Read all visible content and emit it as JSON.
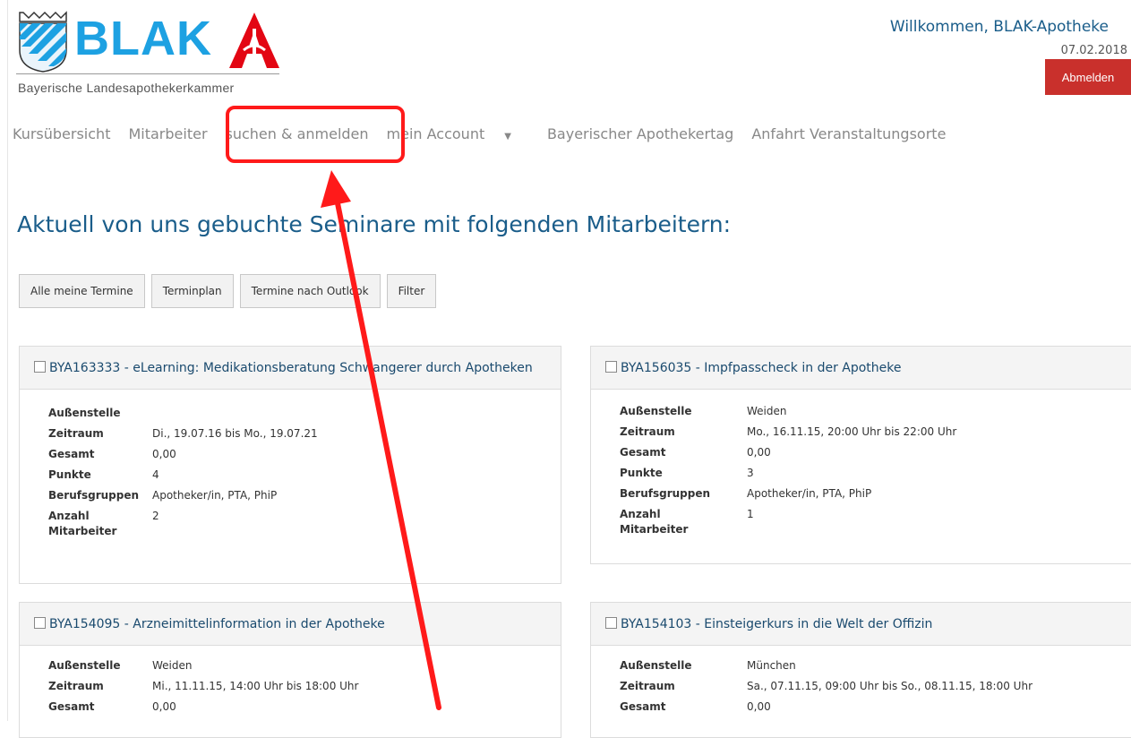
{
  "logo": {
    "word": "BLAK",
    "subtitle": "Bayerische Landesapothekerkammer"
  },
  "header": {
    "welcome": "Willkommen, BLAK-Apotheke",
    "date": "07.02.2018",
    "logout_label": "Abmelden"
  },
  "nav": {
    "items": [
      {
        "label": "Kursübersicht"
      },
      {
        "label": "Mitarbeiter"
      },
      {
        "label": "suchen & anmelden"
      },
      {
        "label": "mein Account"
      },
      {
        "label": "Bayerischer Apothekertag"
      },
      {
        "label": "Anfahrt Veranstaltungsorte"
      }
    ]
  },
  "heading": "Aktuell von uns gebuchte Seminare mit folgenden Mitarbeitern:",
  "buttons": [
    "Alle meine Termine",
    "Terminplan",
    "Termine nach Outlook",
    "Filter"
  ],
  "cards": [
    {
      "title": "BYA163333 - eLearning: Medikationsberatung Schwangerer durch Apotheken",
      "rows": [
        {
          "label": "Außenstelle",
          "value": ""
        },
        {
          "label": "Zeitraum",
          "value": "Di., 19.07.16 bis Mo., 19.07.21"
        },
        {
          "label": "Gesamt",
          "value": "0,00"
        },
        {
          "label": "Punkte",
          "value": "4"
        },
        {
          "label": "Berufsgruppen",
          "value": "Apotheker/in, PTA, PhiP"
        },
        {
          "label": "Anzahl Mitarbeiter",
          "value": "2"
        }
      ]
    },
    {
      "title": "BYA156035 - Impfpasscheck in der Apotheke",
      "rows": [
        {
          "label": "Außenstelle",
          "value": "Weiden"
        },
        {
          "label": "Zeitraum",
          "value": "Mo., 16.11.15, 20:00 Uhr bis 22:00 Uhr"
        },
        {
          "label": "Gesamt",
          "value": "0,00"
        },
        {
          "label": "Punkte",
          "value": "3"
        },
        {
          "label": "Berufsgruppen",
          "value": "Apotheker/in, PTA, PhiP"
        },
        {
          "label": "Anzahl Mitarbeiter",
          "value": "1"
        }
      ]
    },
    {
      "title": "BYA154095 - Arzneimittelinformation in der Apotheke",
      "rows": [
        {
          "label": "Außenstelle",
          "value": "Weiden"
        },
        {
          "label": "Zeitraum",
          "value": "Mi., 11.11.15, 14:00 Uhr bis 18:00 Uhr"
        },
        {
          "label": "Gesamt",
          "value": "0,00"
        }
      ]
    },
    {
      "title": "BYA154103 - Einsteigerkurs in die Welt der Offizin",
      "rows": [
        {
          "label": "Außenstelle",
          "value": "München"
        },
        {
          "label": "Zeitraum",
          "value": "Sa., 07.11.15, 09:00 Uhr bis So., 08.11.15, 18:00 Uhr"
        },
        {
          "label": "Gesamt",
          "value": "0,00"
        }
      ]
    }
  ],
  "colors": {
    "brand_blue": "#1da1e2",
    "logout_red": "#c9302c",
    "heading_blue": "#1a5d8a",
    "annotation_red": "#ff1a1a"
  },
  "icons": [
    "bavarian-crest-icon",
    "apotheke-a-icon",
    "checkbox-icon",
    "caret-down-icon"
  ]
}
